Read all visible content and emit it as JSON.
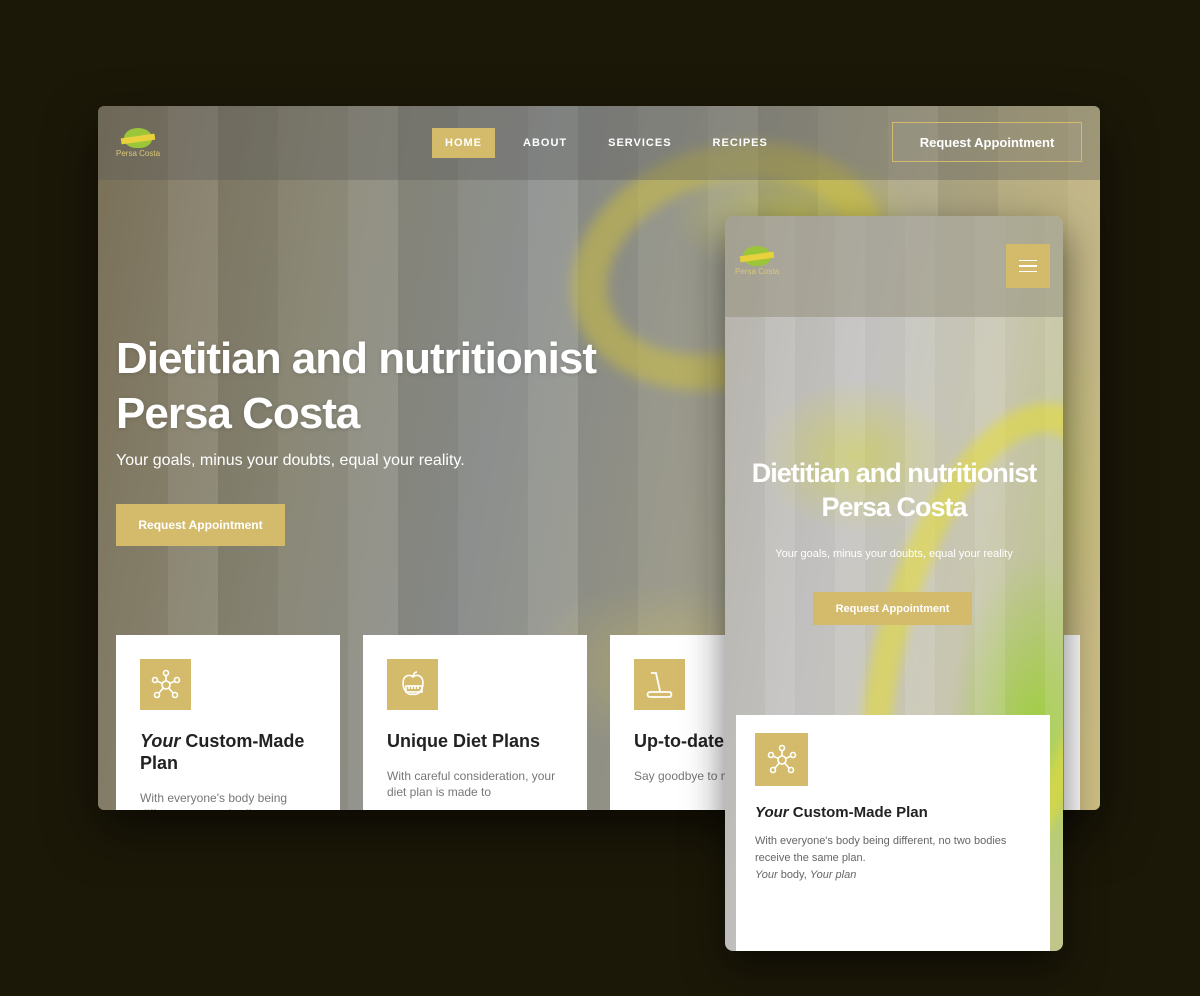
{
  "brand": {
    "logo_text": "Persa Costa",
    "accent_color": "#d4bb6c",
    "background_color": "#1c1808"
  },
  "desktop": {
    "nav": {
      "items": [
        {
          "label": "HOME",
          "active": true
        },
        {
          "label": "ABOUT",
          "active": false
        },
        {
          "label": "SERVICES",
          "active": false
        },
        {
          "label": "RECIPES",
          "active": false
        }
      ]
    },
    "header_cta": "Request Appointment",
    "hero": {
      "title_line1": "Dietitian and nutritionist",
      "title_line2": "Persa Costa",
      "subtitle": "Your goals, minus your doubts, equal your reality.",
      "button": "Request Appointment"
    },
    "cards": [
      {
        "icon": "network-nodes-icon",
        "title_em": "Your",
        "title_rest": " Custom-Made Plan",
        "text": "With everyone's body being different, no two bodies"
      },
      {
        "icon": "apple-measure-icon",
        "title_em": "",
        "title_rest": "Unique Diet Plans",
        "text": "With careful consideration, your diet plan is made to"
      },
      {
        "icon": "treadmill-icon",
        "title_em": "",
        "title_rest": "Up-to-date",
        "text": "Say goodbye to methods, diet re"
      }
    ]
  },
  "mobile": {
    "menu_icon": "hamburger-icon",
    "hero": {
      "title_line1": "Dietitian and nutritionist",
      "title_line2": "Persa Costa",
      "subtitle": "Your goals, minus your doubts, equal your reality",
      "button": "Request Appointment"
    },
    "card": {
      "icon": "network-nodes-icon",
      "title_em": "Your",
      "title_rest": " Custom-Made Plan",
      "text_line1": "With everyone's body being different, no two bodies",
      "text_line2": "receive the same plan.",
      "text_em1": "Your",
      "text_mid": " body, ",
      "text_em2": "Your plan"
    }
  }
}
